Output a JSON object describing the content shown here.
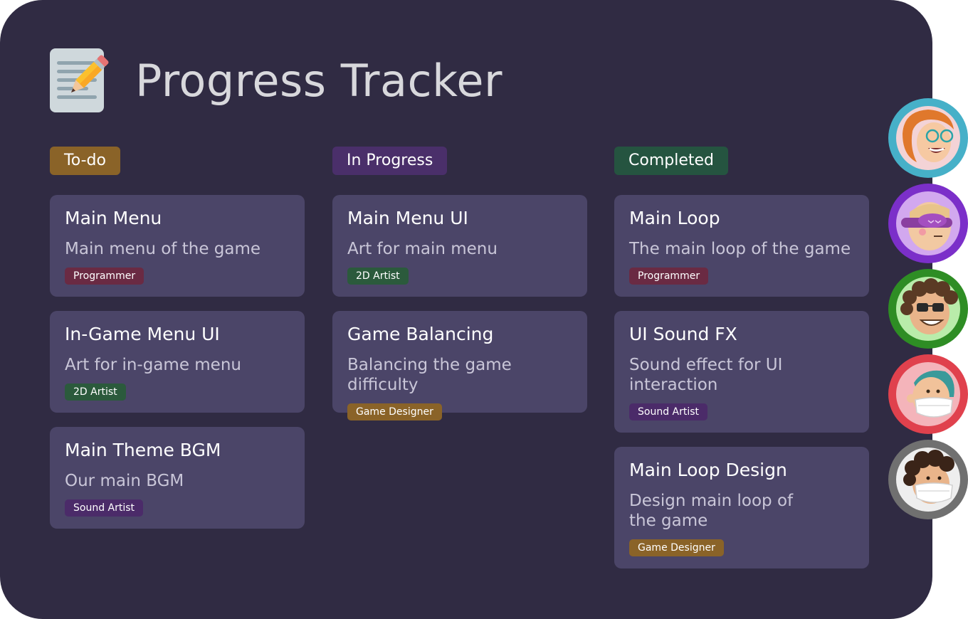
{
  "app": {
    "title": "Progress Tracker",
    "logo_icon": "memo-pencil-icon"
  },
  "colors": {
    "background": "#302b43",
    "card": "#4b4568",
    "todo": "#8a6328",
    "in_progress": "#4a2f6a",
    "completed": "#255440",
    "programmer": "#6a2a43",
    "artist_2d": "#2b5a3c",
    "sound_artist": "#4b2b69",
    "game_designer": "#8a6328"
  },
  "columns": [
    {
      "label": "To-do",
      "cards": [
        {
          "title": "Main Menu",
          "description": "Main menu of the game",
          "tag": "Programmer"
        },
        {
          "title": "In-Game Menu UI",
          "description": "Art for in-game menu",
          "tag": "2D Artist"
        },
        {
          "title": "Main Theme BGM",
          "description": "Our main BGM",
          "tag": "Sound Artist"
        }
      ]
    },
    {
      "label": "In Progress",
      "cards": [
        {
          "title": "Main Menu UI",
          "description": "Art for main menu",
          "tag": "2D Artist"
        },
        {
          "title": "Game Balancing",
          "description": "Balancing the game difficulty",
          "tag": "Game Designer"
        }
      ]
    },
    {
      "label": "Completed",
      "cards": [
        {
          "title": "Main Loop",
          "description": "The main loop of the game",
          "tag": "Programmer"
        },
        {
          "title": "UI Sound FX",
          "description": "Sound effect for UI interaction",
          "tag": "Sound Artist"
        },
        {
          "title": "Main Loop Design",
          "description": "Design main loop of the game",
          "tag": "Game Designer"
        }
      ]
    }
  ],
  "avatars": [
    {
      "icon": "avatar-redhead-glasses-icon",
      "ring": "#46b0c8"
    },
    {
      "icon": "avatar-sleep-mask-icon",
      "ring": "#7b2fc9"
    },
    {
      "icon": "avatar-curly-sunglasses-icon",
      "ring": "#2e8d24"
    },
    {
      "icon": "avatar-teal-hair-mask-icon",
      "ring": "#e0414d"
    },
    {
      "icon": "avatar-curly-mask-icon",
      "ring": "#707070"
    }
  ]
}
